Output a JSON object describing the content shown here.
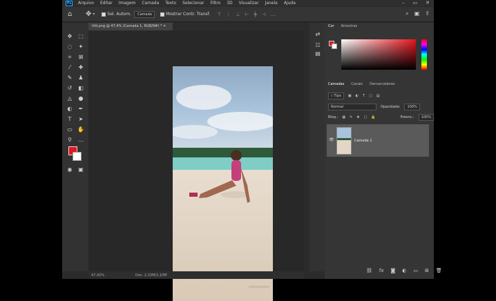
{
  "menu": {
    "logo": "Ps",
    "items": [
      "Arquivo",
      "Editar",
      "Imagem",
      "Camada",
      "Texto",
      "Selecionar",
      "Filtro",
      "3D",
      "Visualizar",
      "Janela",
      "Ajuda"
    ]
  },
  "options": {
    "auto_select_label": "Sel. Autom.",
    "auto_select_value": "Camada",
    "show_transform_label": "Mostrar Contr. Transf."
  },
  "document": {
    "tab_title": "hfd.png @ 47,4% (Camada 1, RGB/8#) *",
    "zoom": "47,42%",
    "doc_info": "Doc: 2,10M/2,10M"
  },
  "color_panel": {
    "tabs": [
      "Cor",
      "Amostras"
    ],
    "foreground": "#e8141e",
    "background": "#ffffff"
  },
  "layers_panel": {
    "tabs": [
      "Camadas",
      "Canais",
      "Demarcadores"
    ],
    "filter": "Tipo",
    "blend_mode": "Normal",
    "opacity_label": "Opacidade:",
    "opacity_value": "100%",
    "lock_label": "Bloq.:",
    "fill_label": "Preenc.:",
    "fill_value": "100%",
    "layer_name": "Camada 1"
  },
  "toolbar": {
    "icons": [
      "move-icon",
      "marquee-icon",
      "lasso-icon",
      "magic-wand-icon",
      "crop-icon",
      "frame-icon",
      "eyedropper-icon",
      "healing-icon",
      "brush-icon",
      "stamp-icon",
      "history-brush-icon",
      "eraser-icon",
      "bucket-icon",
      "blur-icon",
      "dodge-icon",
      "pen-icon",
      "type-icon",
      "path-select-icon",
      "rectangle-icon",
      "hand-icon",
      "zoom-icon",
      "more-icon"
    ]
  }
}
